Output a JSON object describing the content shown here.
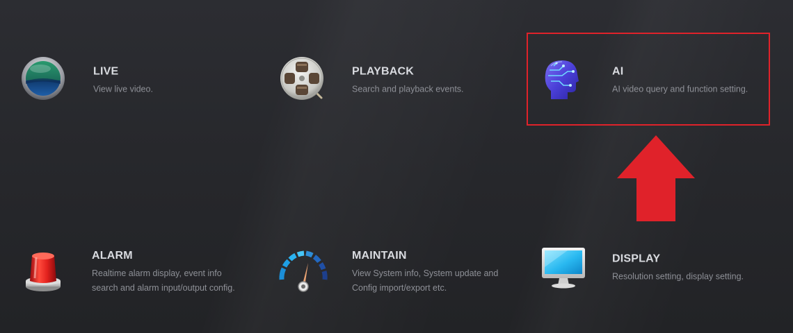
{
  "menu": {
    "items": [
      {
        "key": "live",
        "title": "LIVE",
        "description": "View live video.",
        "icon": "globe-icon"
      },
      {
        "key": "playback",
        "title": "PLAYBACK",
        "description": "Search and playback events.",
        "icon": "film-reel-icon"
      },
      {
        "key": "ai",
        "title": "AI",
        "description": "AI video query and function setting.",
        "icon": "ai-head-icon"
      },
      {
        "key": "alarm",
        "title": "ALARM",
        "description": "Realtime alarm display, event info\nsearch and alarm input/output config.",
        "icon": "alarm-light-icon"
      },
      {
        "key": "maintain",
        "title": "MAINTAIN",
        "description": "View System info, System update and\nConfig import/export etc.",
        "icon": "gauge-icon"
      },
      {
        "key": "display",
        "title": "DISPLAY",
        "description": "Resolution setting, display setting.",
        "icon": "monitor-icon"
      }
    ]
  },
  "annotation": {
    "highlighted_item": "AI",
    "highlight_color": "#e0222a",
    "pointer_icon": "up-arrow-icon"
  },
  "colors": {
    "background": "#29292d",
    "title": "#d9dbe0",
    "description": "#8e9097"
  }
}
